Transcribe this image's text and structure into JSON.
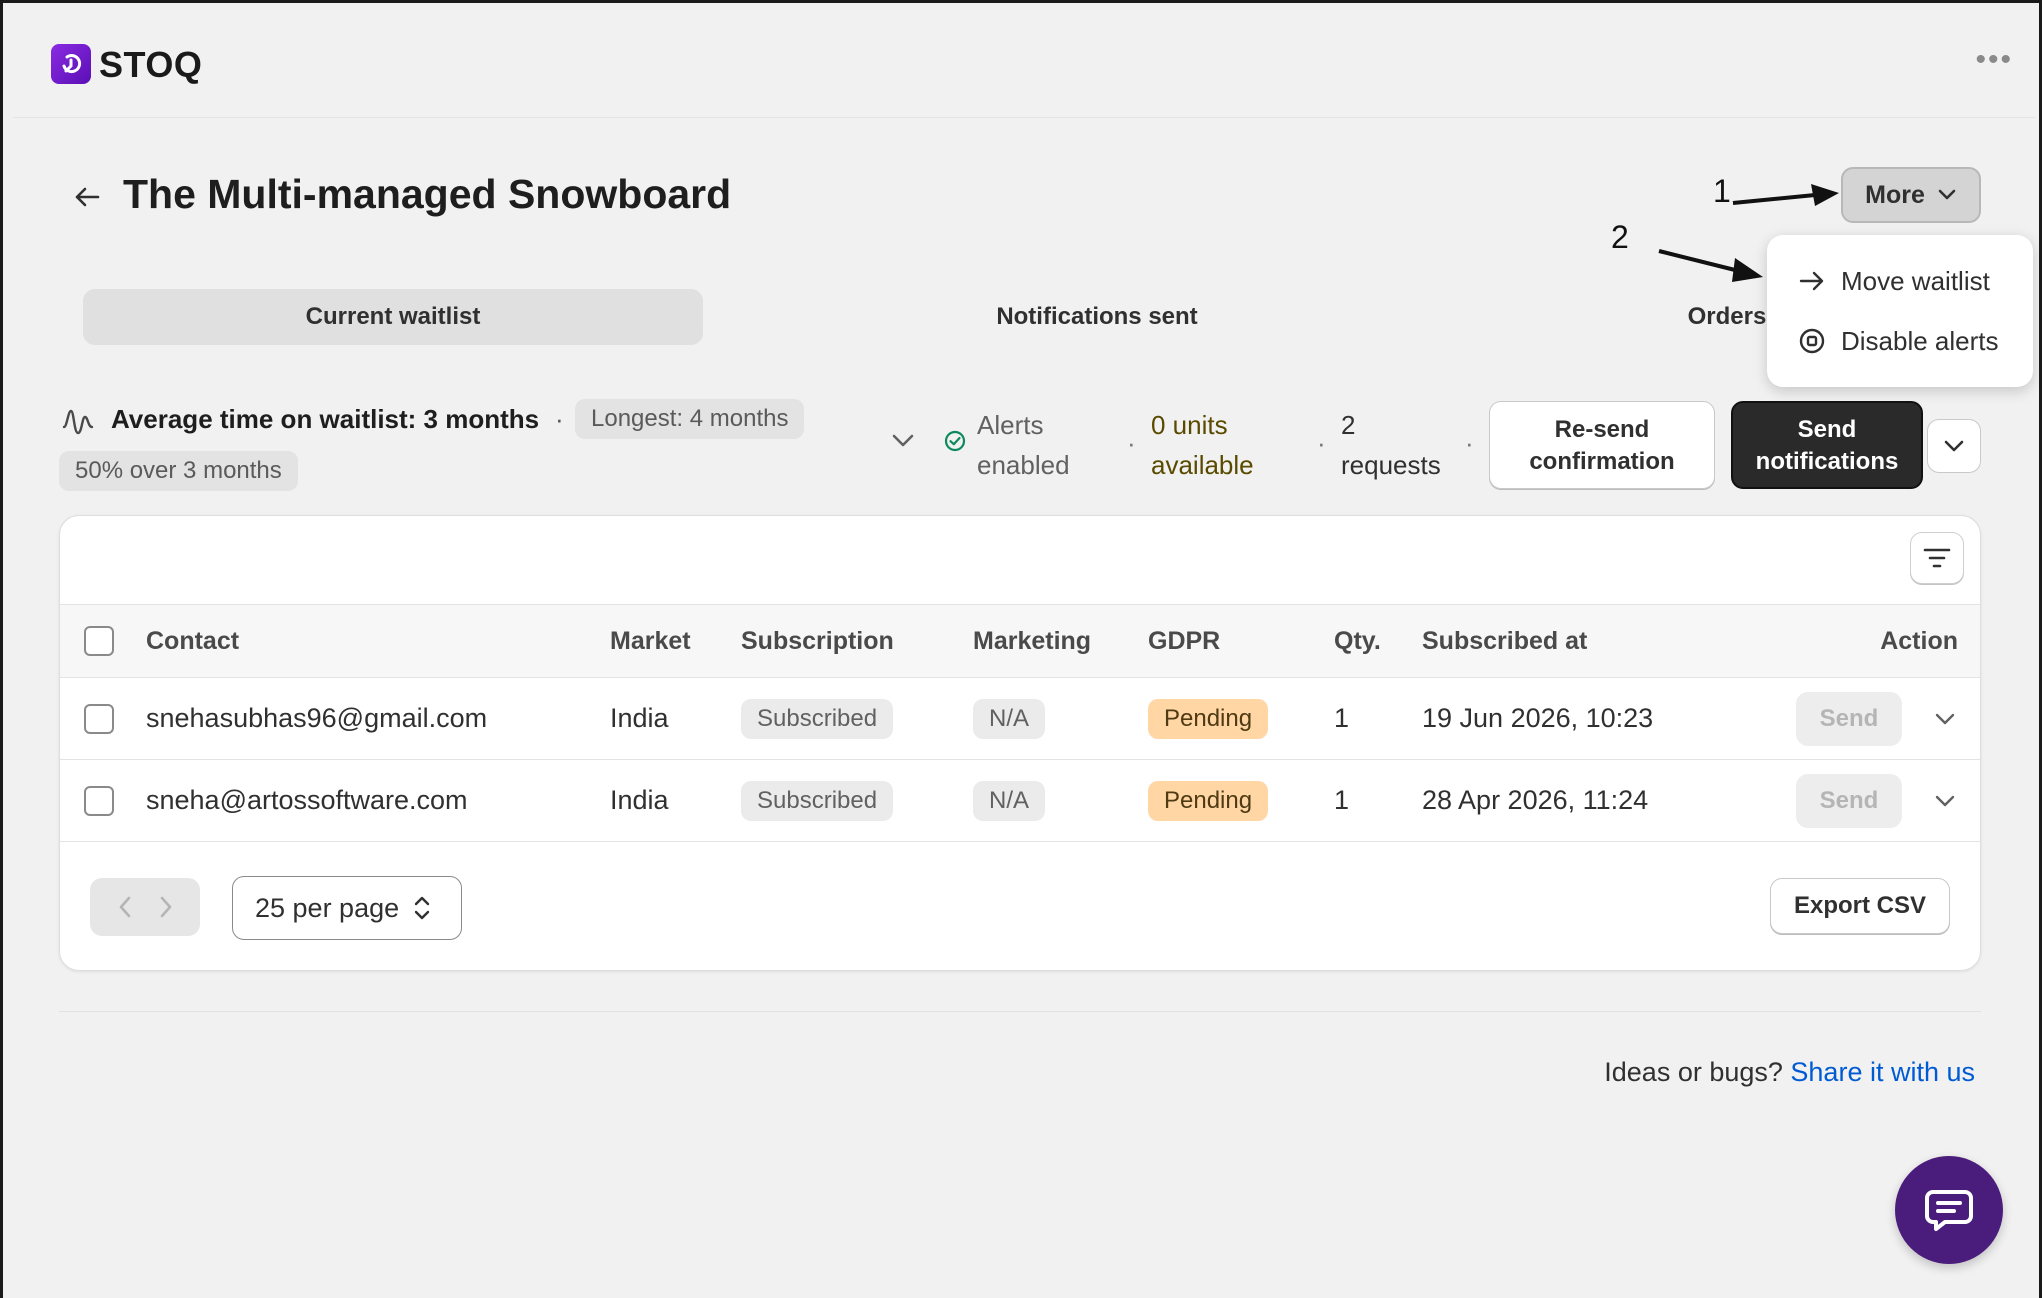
{
  "app": {
    "name": "STOQ",
    "menu_icon": "more-horizontal-icon"
  },
  "header": {
    "title": "The Multi-managed Snowboard",
    "more_label": "More",
    "annotations": [
      "1",
      "2"
    ]
  },
  "more_menu": {
    "items": [
      {
        "label": "Move waitlist",
        "icon": "arrow-right-icon"
      },
      {
        "label": "Disable alerts",
        "icon": "stop-circle-icon"
      }
    ]
  },
  "tabs": [
    {
      "label": "Current waitlist",
      "active": true
    },
    {
      "label": "Notifications sent",
      "active": false
    },
    {
      "label": "Orders",
      "active": false
    }
  ],
  "stats": {
    "average": "Average time on waitlist: 3 months",
    "separator": "·",
    "longest": "Longest: 4 months",
    "over": "50% over 3 months",
    "alerts_line1": "Alerts",
    "alerts_line2": "enabled",
    "units_line1": "0 units",
    "units_line2": "available",
    "requests_line1": "2",
    "requests_line2": "requests",
    "resend_line1": "Re-send",
    "resend_line2": "confirmation",
    "send_line1": "Send",
    "send_line2": "notifications",
    "colors": {
      "success": "#0c8a5d",
      "units": "#5a4a00"
    }
  },
  "table": {
    "columns": [
      "Contact",
      "Market",
      "Subscription",
      "Marketing",
      "GDPR",
      "Qty.",
      "Subscribed at",
      "Action"
    ],
    "rows": [
      {
        "contact": "snehasubhas96@gmail.com",
        "market": "India",
        "subscription": "Subscribed",
        "marketing": "N/A",
        "gdpr": "Pending",
        "qty": "1",
        "subscribed_at": "19 Jun 2026, 10:23",
        "action": "Send"
      },
      {
        "contact": "sneha@artossoftware.com",
        "market": "India",
        "subscription": "Subscribed",
        "marketing": "N/A",
        "gdpr": "Pending",
        "qty": "1",
        "subscribed_at": "28 Apr 2026, 11:24",
        "action": "Send"
      }
    ],
    "per_page": "25 per page",
    "export_label": "Export CSV"
  },
  "footer": {
    "text": "Ideas or bugs?",
    "link": "Share it with us",
    "link_color": "#005bd3"
  },
  "chat": {
    "icon": "chat-icon",
    "color": "#4a1c7c"
  }
}
